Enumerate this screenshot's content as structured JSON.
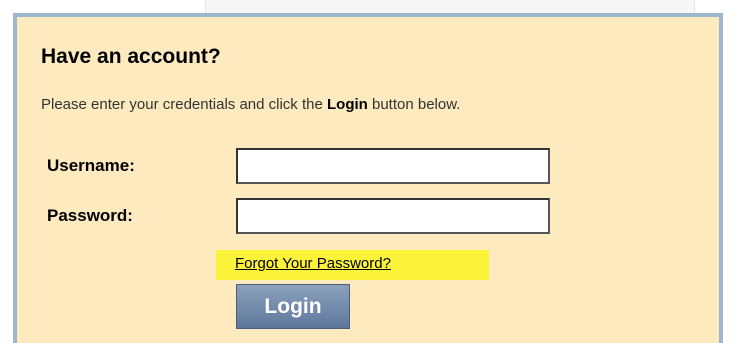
{
  "login": {
    "title": "Have an account?",
    "instructions_prefix": "Please enter your credentials and click the ",
    "instructions_bold": "Login",
    "instructions_suffix": " button below.",
    "username_label": "Username:",
    "username_value": "",
    "password_label": "Password:",
    "password_value": "",
    "forgot_password_link": "Forgot Your Password?",
    "login_button_label": "Login"
  },
  "colors": {
    "panel_background": "#fdeabf",
    "panel_border": "#9eb6cf",
    "highlight": "#fbf33a",
    "button": "#6f87a9"
  }
}
